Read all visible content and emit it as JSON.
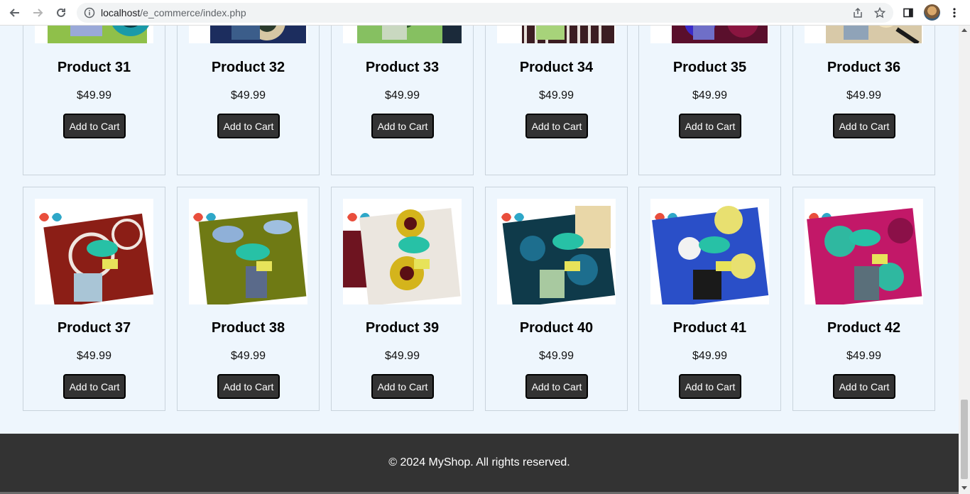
{
  "browser": {
    "url_host": "localhost",
    "url_path": "/e_commerce/index.php"
  },
  "products_top": [
    {
      "name": "Product 31",
      "price": "$49.99",
      "button": "Add to Cart"
    },
    {
      "name": "Product 32",
      "price": "$49.99",
      "button": "Add to Cart"
    },
    {
      "name": "Product 33",
      "price": "$49.99",
      "button": "Add to Cart"
    },
    {
      "name": "Product 34",
      "price": "$49.99",
      "button": "Add to Cart"
    },
    {
      "name": "Product 35",
      "price": "$49.99",
      "button": "Add to Cart"
    },
    {
      "name": "Product 36",
      "price": "$49.99",
      "button": "Add to Cart"
    }
  ],
  "products_bottom": [
    {
      "name": "Product 37",
      "price": "$49.99",
      "button": "Add to Cart"
    },
    {
      "name": "Product 38",
      "price": "$49.99",
      "button": "Add to Cart"
    },
    {
      "name": "Product 39",
      "price": "$49.99",
      "button": "Add to Cart"
    },
    {
      "name": "Product 40",
      "price": "$49.99",
      "button": "Add to Cart"
    },
    {
      "name": "Product 41",
      "price": "$49.99",
      "button": "Add to Cart"
    },
    {
      "name": "Product 42",
      "price": "$49.99",
      "button": "Add to Cart"
    }
  ],
  "footer": {
    "text": "© 2024 MyShop. All rights reserved."
  },
  "colors": {
    "page_bg": "#eef6fd",
    "button_bg": "#333333",
    "footer_bg": "#333333"
  }
}
